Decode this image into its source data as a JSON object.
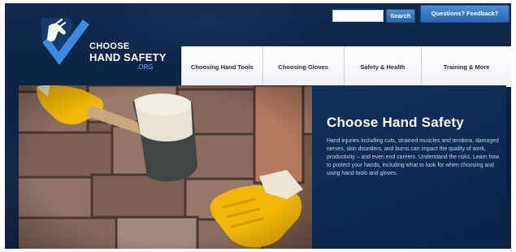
{
  "logo": {
    "choose": "CHOOSE",
    "hand_safety": "HAND SAFETY",
    "org": ".ORG"
  },
  "search": {
    "placeholder": "",
    "button_label": "Search"
  },
  "feedback": {
    "label": "Questions? Feedback?"
  },
  "nav": {
    "items": [
      {
        "label": "Choosing Hand Tools"
      },
      {
        "label": "Choosing Gloves"
      },
      {
        "label": "Safety & Health"
      },
      {
        "label": "Training & More"
      }
    ]
  },
  "hero": {
    "title": "Choose Hand Safety",
    "body": "Hand injuries including cuts, strained muscles and tendons, damaged nerves, skin disorders, and burns can impact the quality of work, productivity – and even end careers. Understand the risks. Learn how to protect your hands, including what to look for when choosing and using hand tools and gloves."
  },
  "colors": {
    "page_background": "#0b2142",
    "nav_background": "#ffffff",
    "accent_button": "#2b64ad",
    "logo_check": "#3b8be0",
    "glove_yellow": "#f2b705"
  }
}
